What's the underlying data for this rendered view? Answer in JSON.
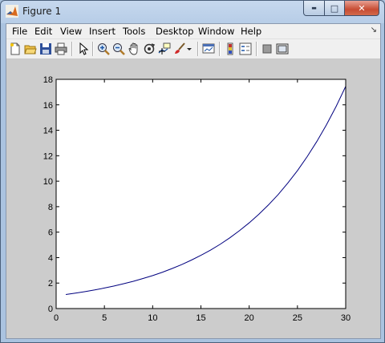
{
  "window": {
    "title": "Figure 1",
    "controls": {
      "minimize": "▬",
      "maximize": "□",
      "close": "✕"
    }
  },
  "menubar": {
    "items": [
      "File",
      "Edit",
      "View",
      "Insert",
      "Tools",
      "Desktop",
      "Window",
      "Help"
    ],
    "overflow_icon": "arrow-icon"
  },
  "toolbar": {
    "buttons": [
      "new-figure-icon",
      "open-file-icon",
      "save-icon",
      "print-icon",
      "edit-plot-arrow-icon",
      "zoom-in-icon",
      "zoom-out-icon",
      "pan-hand-icon",
      "rotate-3d-icon",
      "data-cursor-icon",
      "brush-icon",
      "brush-dropdown-icon",
      "link-plot-icon",
      "colorbar-icon",
      "legend-icon",
      "hide-plot-tools-icon",
      "show-plot-tools-icon"
    ]
  },
  "chart_data": {
    "type": "line",
    "title": "",
    "xlabel": "",
    "ylabel": "",
    "xlim": [
      0,
      30
    ],
    "ylim": [
      0,
      18
    ],
    "xticks": [
      "0",
      "5",
      "10",
      "15",
      "20",
      "25",
      "30"
    ],
    "yticks": [
      "0",
      "2",
      "4",
      "6",
      "8",
      "10",
      "12",
      "14",
      "16",
      "18"
    ],
    "grid": false,
    "series": [
      {
        "color": "#00007f",
        "x": [
          1,
          2,
          3,
          4,
          5,
          6,
          7,
          8,
          9,
          10,
          11,
          12,
          13,
          14,
          15,
          16,
          17,
          18,
          19,
          20,
          21,
          22,
          23,
          24,
          25,
          26,
          27,
          28,
          29,
          30
        ],
        "y": [
          1.1,
          1.21,
          1.33,
          1.46,
          1.61,
          1.77,
          1.95,
          2.14,
          2.36,
          2.59,
          2.85,
          3.14,
          3.45,
          3.8,
          4.18,
          4.59,
          5.05,
          5.56,
          6.12,
          6.73,
          7.4,
          8.14,
          8.95,
          9.85,
          10.83,
          11.92,
          13.11,
          14.42,
          15.86,
          17.45
        ]
      }
    ]
  }
}
